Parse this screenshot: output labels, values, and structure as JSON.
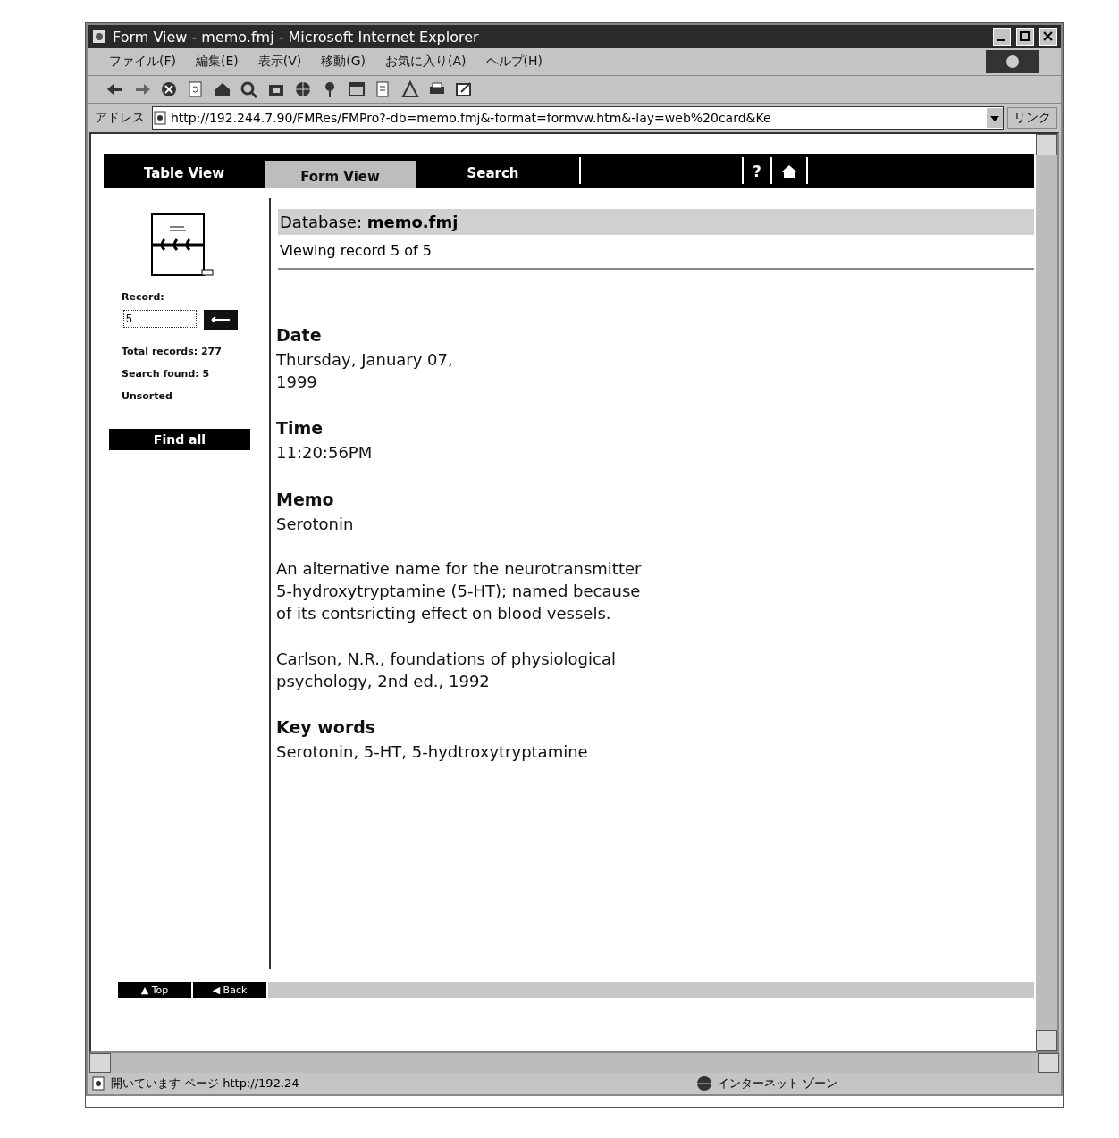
{
  "window": {
    "title": "Form View - memo.fmj - Microsoft Internet Explorer"
  },
  "menu": [
    "ファイル(F)",
    "編集(E)",
    "表示(V)",
    "移動(G)",
    "お気に入り(A)",
    "ヘルプ(H)"
  ],
  "address": {
    "label": "アドレス",
    "value": "http://192.244.7.90/FMRes/FMPro?-db=memo.fmj&-format=formvw.htm&-lay=web%20card&Ke",
    "links": "リンク"
  },
  "tabs": [
    {
      "label": "Table View",
      "selected": false
    },
    {
      "label": "Form View",
      "selected": true
    },
    {
      "label": "Search",
      "selected": false
    }
  ],
  "help_link": "?",
  "sidebar": {
    "record_label": "Record:",
    "record_value": "5",
    "stats": [
      "Total records: 277",
      "Search found: 5",
      "Unsorted"
    ],
    "find_all": "Find all"
  },
  "header": {
    "title": "Database: **memo.fmj**",
    "subtitle": "Viewing record 5 of 5"
  },
  "fields": [
    {
      "label": "Date",
      "value": "Thursday, January 07,\n1999"
    },
    {
      "label": "Time",
      "value": "11:20:56PM"
    },
    {
      "label": "Memo",
      "value": "Serotonin\n\nAn alternative name for the neurotransmitter\n5-hydroxytryptamine (5-HT); named because\nof its contsricting effect on blood vessels.\n\nCarlson, N.R., foundations of physiological\npsychology, 2nd ed., 1992"
    },
    {
      "label": "Key words",
      "value": "Serotonin, 5-HT, 5-hydtroxytryptamine"
    }
  ],
  "footer_buttons": [
    "▲ Top",
    "◀ Back"
  ],
  "status_bar": {
    "text": "開いています ページ http://192.24",
    "zone": "インターネット ゾーン"
  }
}
